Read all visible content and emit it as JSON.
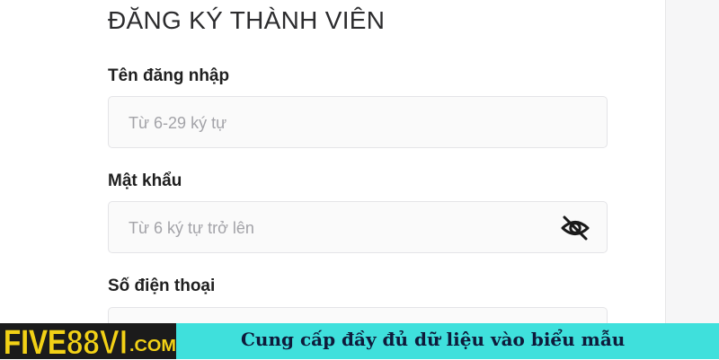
{
  "form": {
    "title": "ĐĂNG KÝ THÀNH VIÊN",
    "username": {
      "label": "Tên đăng nhập",
      "placeholder": "Từ 6-29 ký tự",
      "value": ""
    },
    "password": {
      "label": "Mật khẩu",
      "placeholder": "Từ 6 ký tự trở lên",
      "value": "",
      "toggle_icon": "eye-off-icon"
    },
    "phone": {
      "label": "Số điện thoại",
      "value": ""
    }
  },
  "banner": {
    "logo_text_a": "FIVE",
    "logo_text_b": "88VI",
    "logo_text_c": ".COM",
    "caption": "Cung cấp đầy đủ dữ liệu vào biểu mẫu",
    "colors": {
      "background": "#3fe0dc",
      "logo_yellow": "#f2d116",
      "logo_dark": "#1b1b1b",
      "caption": "#0e1a3a"
    }
  }
}
